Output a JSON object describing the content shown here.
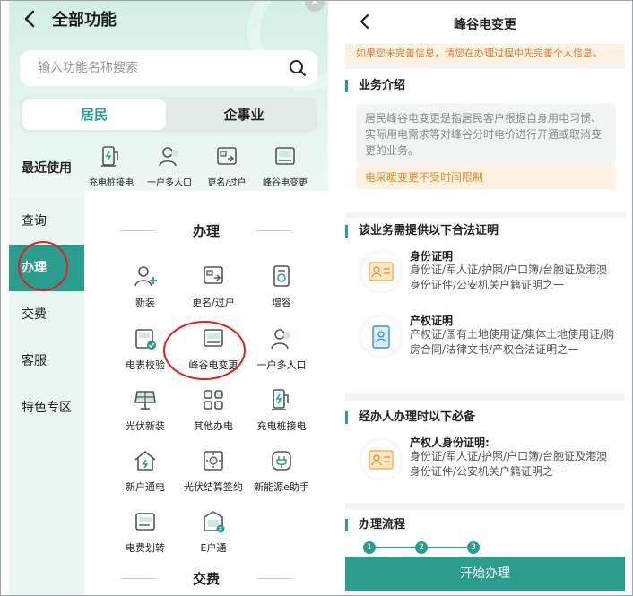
{
  "colors": {
    "accent": "#2a9d8f",
    "annotation": "#e02020",
    "notice": "#e07a2c"
  },
  "left": {
    "back_icon": "chevron-left-icon",
    "title": "全部功能",
    "search": {
      "placeholder": "输入功能名称搜索",
      "icon": "search-icon"
    },
    "segments": [
      "居民",
      "企事业"
    ],
    "active_segment": "居民",
    "recent": {
      "label": "最近使用",
      "items": [
        "充电桩接电",
        "一户多人口",
        "更名/过户",
        "峰谷电变更"
      ]
    },
    "side_nav": [
      "查询",
      "办理",
      "交费",
      "客服",
      "特色专区"
    ],
    "active_nav": "办理",
    "section_title": "办理",
    "next_section_title": "交费",
    "grid": [
      [
        "新装",
        "更名/过户",
        "增容"
      ],
      [
        "电表校验",
        "峰谷电变更",
        "一户多人口"
      ],
      [
        "光伏新装",
        "其他办电",
        "充电桩接电"
      ],
      [
        "新户通电",
        "光伏结算签约",
        "新能源e助手"
      ],
      [
        "电费划转",
        "E户通"
      ]
    ]
  },
  "right": {
    "back_icon": "chevron-left-icon",
    "title": "峰谷电变更",
    "notice": "如果您未完善信息，请您在办理过程中先完善个人信息。",
    "intro": {
      "title": "业务介绍",
      "desc": "居民峰谷电变更是指居民客户根据自身用电习惯、实际用电需求等对峰谷分时电价进行开通或取消变更的业务。",
      "warning": "电采暖变更不受时间限制"
    },
    "proofs": {
      "title": "该业务需提供以下合法证明",
      "items": [
        {
          "title": "身份证明",
          "desc": "身份证/军人证/护照/户口簿/台胞证及港澳身份证件/公安机关户籍证明之一"
        },
        {
          "title": "产权证明",
          "desc": "产权证/国有土地使用证/集体土地使用证/购房合同/法律文书/产权合法证明之一"
        }
      ]
    },
    "agent": {
      "title": "经办人办理时以下必备",
      "item": {
        "title": "产权人身份证明:",
        "desc": "身份证/军人证/护照/户口簿/台胞证及港澳身份证件/公安机关户籍证明之一"
      }
    },
    "process": {
      "title": "办理流程",
      "steps": [
        "1",
        "2",
        "3"
      ]
    },
    "start_button": "开始办理"
  }
}
